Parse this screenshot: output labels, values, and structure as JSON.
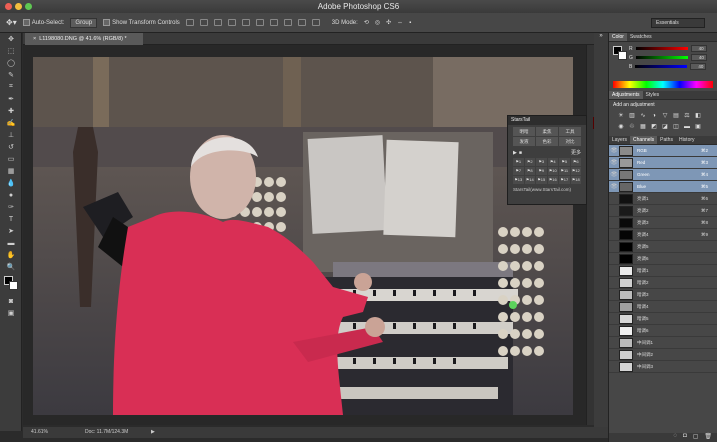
{
  "window": {
    "title": "Adobe Photoshop CS6"
  },
  "options": {
    "auto_select": "Auto-Select:",
    "group": "Group",
    "show_transform": "Show Transform Controls",
    "mode_3d": "3D Mode:",
    "workspace": "Essentials"
  },
  "document": {
    "tab": "L1198080.DNG @ 41.6% (RGB/8) *"
  },
  "status": {
    "zoom": "41.61%",
    "doc": "Doc: 11.7M/124.3M"
  },
  "color": {
    "tabs": [
      "Color",
      "Swatches"
    ],
    "r": "40",
    "g": "40",
    "b": "40",
    "labels": [
      "R",
      "G",
      "B"
    ]
  },
  "adjust": {
    "tabs": [
      "Adjustments",
      "Styles"
    ],
    "heading": "Add an adjustment"
  },
  "layers": {
    "tabs": [
      "Layers",
      "Channels",
      "Paths",
      "History"
    ],
    "rows": [
      {
        "name": "RGB",
        "sc": "⌘2",
        "sel": true,
        "thumb": "#8a8a8a"
      },
      {
        "name": "Red",
        "sc": "⌘3",
        "sel": true,
        "thumb": "#999"
      },
      {
        "name": "Green",
        "sc": "⌘4",
        "sel": true,
        "thumb": "#777"
      },
      {
        "name": "Blue",
        "sc": "⌘5",
        "sel": true,
        "thumb": "#666"
      },
      {
        "name": "亮调1",
        "sc": "⌘6",
        "sel": false,
        "thumb": "#111"
      },
      {
        "name": "亮调2",
        "sc": "⌘7",
        "sel": false,
        "thumb": "#1a1a1a"
      },
      {
        "name": "亮调3",
        "sc": "⌘8",
        "sel": false,
        "thumb": "#0a0a0a"
      },
      {
        "name": "亮调4",
        "sc": "⌘9",
        "sel": false,
        "thumb": "#050505"
      },
      {
        "name": "亮调5",
        "sc": "",
        "sel": false,
        "thumb": "#000"
      },
      {
        "name": "亮调6",
        "sc": "",
        "sel": false,
        "thumb": "#000"
      },
      {
        "name": "暗调1",
        "sc": "",
        "sel": false,
        "thumb": "#eaeaea"
      },
      {
        "name": "暗调2",
        "sc": "",
        "sel": false,
        "thumb": "#cfcfcf"
      },
      {
        "name": "暗调3",
        "sc": "",
        "sel": false,
        "thumb": "#bdbdbd"
      },
      {
        "name": "暗调4",
        "sc": "",
        "sel": false,
        "thumb": "#a0a0a0"
      },
      {
        "name": "暗调5",
        "sc": "",
        "sel": false,
        "thumb": "#d8d8d8"
      },
      {
        "name": "暗调6",
        "sc": "",
        "sel": false,
        "thumb": "#f0f0f0"
      },
      {
        "name": "中间调1",
        "sc": "",
        "sel": false,
        "thumb": "#bbb"
      },
      {
        "name": "中间调2",
        "sc": "",
        "sel": false,
        "thumb": "#ccc"
      },
      {
        "name": "中间调3",
        "sc": "",
        "sel": false,
        "thumb": "#d4d4d4"
      }
    ]
  },
  "starstail": {
    "title": "StarsTail",
    "btns": [
      "明暗",
      "柔焦",
      "工具",
      "发液",
      "色彩",
      "对比"
    ],
    "nums": [
      "⚑1",
      "⚑2",
      "⚑3",
      "⚑4",
      "⚑5",
      "⚑6",
      "⚑7",
      "⚑8",
      "⚑9",
      "⚑10",
      "⚑11",
      "⚑12",
      "⚑13",
      "⚑14",
      "⚑15",
      "⚑16",
      "⚑17",
      "⚑18"
    ],
    "footer": "StarsTail(www.StarsTail.com)",
    "more": "更多"
  }
}
